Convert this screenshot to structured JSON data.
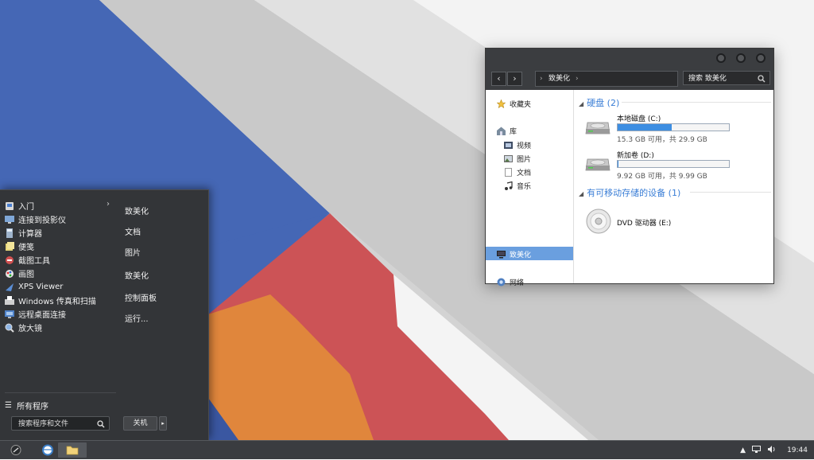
{
  "start_menu": {
    "programs": [
      {
        "label": "入门",
        "icon": "getting-started-icon",
        "has_submenu": true
      },
      {
        "label": "连接到投影仪",
        "icon": "projector-icon"
      },
      {
        "label": "计算器",
        "icon": "calculator-icon"
      },
      {
        "label": "便笺",
        "icon": "sticky-notes-icon"
      },
      {
        "label": "截图工具",
        "icon": "snipping-tool-icon"
      },
      {
        "label": "画图",
        "icon": "paint-icon"
      },
      {
        "label": "XPS Viewer",
        "icon": "xps-viewer-icon"
      },
      {
        "label": "Windows 传真和扫描",
        "icon": "fax-scan-icon"
      },
      {
        "label": "远程桌面连接",
        "icon": "remote-desktop-icon"
      },
      {
        "label": "放大镜",
        "icon": "magnifier-icon"
      }
    ],
    "all_programs": "所有程序",
    "search_placeholder": "搜索程序和文件",
    "places": [
      "致美化",
      "文档",
      "图片",
      "致美化",
      "控制面板",
      "运行..."
    ],
    "shutdown_label": "关机",
    "submenu_arrow": "›",
    "shutdown_arrow": "▸"
  },
  "explorer": {
    "address": {
      "sep": "›",
      "crumb": "致美化"
    },
    "search_placeholder": "搜索 致美化",
    "nav": {
      "favorites": "收藏夹",
      "libraries": "库",
      "lib_items": [
        "视频",
        "图片",
        "文档",
        "音乐"
      ],
      "computer": "致美化",
      "network": "网络"
    },
    "groups": {
      "hard_disks": "硬盘 (2)",
      "removable": "有可移动存储的设备 (1)"
    },
    "drives": [
      {
        "name": "本地磁盘 (C:)",
        "free": "15.3 GB 可用，共 29.9 GB",
        "used_fraction": 0.488
      },
      {
        "name": "新加卷 (D:)",
        "free": "9.92 GB 可用，共 9.99 GB",
        "used_fraction": 0.007
      }
    ],
    "dvd": {
      "name": "DVD 驱动器 (E:)"
    },
    "back_glyph": "‹",
    "forward_glyph": "›"
  },
  "taskbar": {
    "time": "19:44",
    "tray_arrow": "▲"
  },
  "colors": {
    "wallpaper_blue": "#4567b5",
    "wallpaper_red": "#cc5356",
    "wallpaper_orange": "#e0863c",
    "accent": "#3d8ee2"
  }
}
